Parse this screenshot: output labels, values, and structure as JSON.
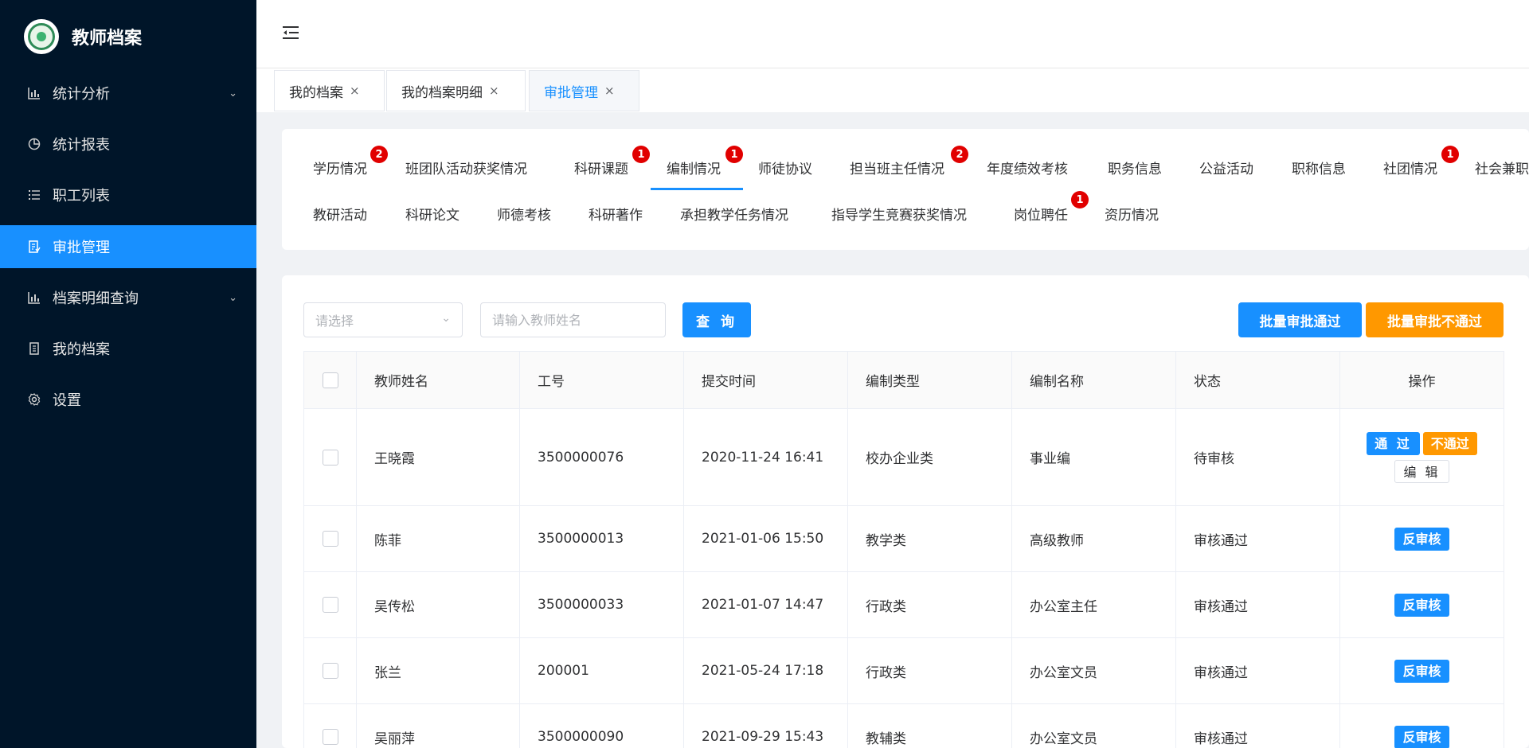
{
  "app": {
    "title": "教师档案"
  },
  "sidebar": {
    "items": [
      {
        "label": "统计分析",
        "icon": "bar-chart-icon",
        "has_submenu": true,
        "active": false
      },
      {
        "label": "统计报表",
        "icon": "pie-chart-icon",
        "has_submenu": false,
        "active": false
      },
      {
        "label": "职工列表",
        "icon": "list-icon",
        "has_submenu": false,
        "active": false
      },
      {
        "label": "审批管理",
        "icon": "document-icon",
        "has_submenu": false,
        "active": true
      },
      {
        "label": "档案明细查询",
        "icon": "bar-chart-icon",
        "has_submenu": true,
        "active": false
      },
      {
        "label": "我的档案",
        "icon": "file-icon",
        "has_submenu": false,
        "active": false
      },
      {
        "label": "设置",
        "icon": "gear-icon",
        "has_submenu": false,
        "active": false
      }
    ]
  },
  "page_tabs": [
    {
      "label": "我的档案",
      "close": "×",
      "active": false
    },
    {
      "label": "我的档案明细",
      "close": "×",
      "active": false
    },
    {
      "label": "审批管理",
      "close": "×",
      "active": true
    }
  ],
  "categories": [
    {
      "label": "学历情况",
      "badge": "2"
    },
    {
      "label": "班团队活动获奖情况",
      "badge": ""
    },
    {
      "label": "科研课题",
      "badge": "1"
    },
    {
      "label": "编制情况",
      "badge": "1",
      "active": true
    },
    {
      "label": "师徒协议",
      "badge": ""
    },
    {
      "label": "担当班主任情况",
      "badge": "2"
    },
    {
      "label": "年度绩效考核",
      "badge": ""
    },
    {
      "label": "职务信息",
      "badge": ""
    },
    {
      "label": "公益活动",
      "badge": ""
    },
    {
      "label": "职称信息",
      "badge": ""
    },
    {
      "label": "社团情况",
      "badge": "1"
    },
    {
      "label": "社会兼职",
      "badge": ""
    },
    {
      "label": "教研活动",
      "badge": ""
    },
    {
      "label": "科研论文",
      "badge": ""
    },
    {
      "label": "师德考核",
      "badge": ""
    },
    {
      "label": "科研著作",
      "badge": ""
    },
    {
      "label": "承担教学任务情况",
      "badge": ""
    },
    {
      "label": "指导学生竞赛获奖情况",
      "badge": ""
    },
    {
      "label": "岗位聘任",
      "badge": "1"
    },
    {
      "label": "资历情况",
      "badge": ""
    }
  ],
  "filters": {
    "select_placeholder": "请选择",
    "name_placeholder": "请输入教师姓名",
    "query_label": "查 询"
  },
  "batch": {
    "pass_label": "批量审批通过",
    "fail_label": "批量审批不通过"
  },
  "table": {
    "columns": [
      "教师姓名",
      "工号",
      "提交时间",
      "编制类型",
      "编制名称",
      "状态",
      "操作"
    ],
    "rows": [
      {
        "name": "王晓霞",
        "id": "3500000076",
        "time": "2020-11-24 16:41",
        "type": "校办企业类",
        "title": "事业编",
        "status": "待审核",
        "actions": [
          "通 过",
          "不通过",
          "编 辑"
        ]
      },
      {
        "name": "陈菲",
        "id": "3500000013",
        "time": "2021-01-06 15:50",
        "type": "教学类",
        "title": "高级教师",
        "status": "审核通过",
        "actions": [
          "反审核"
        ]
      },
      {
        "name": "吴传松",
        "id": "3500000033",
        "time": "2021-01-07 14:47",
        "type": "行政类",
        "title": "办公室主任",
        "status": "审核通过",
        "actions": [
          "反审核"
        ]
      },
      {
        "name": "张兰",
        "id": "200001",
        "time": "2021-05-24 17:18",
        "type": "行政类",
        "title": "办公室文员",
        "status": "审核通过",
        "actions": [
          "反审核"
        ]
      },
      {
        "name": "吴丽萍",
        "id": "3500000090",
        "time": "2021-09-29 15:43",
        "type": "教辅类",
        "title": "办公室文员",
        "status": "审核通过",
        "actions": [
          "反审核"
        ]
      }
    ]
  },
  "colors": {
    "sidebar_bg": "#001529",
    "primary": "#1890ff",
    "warning": "#ff9800",
    "badge": "#e10000"
  }
}
